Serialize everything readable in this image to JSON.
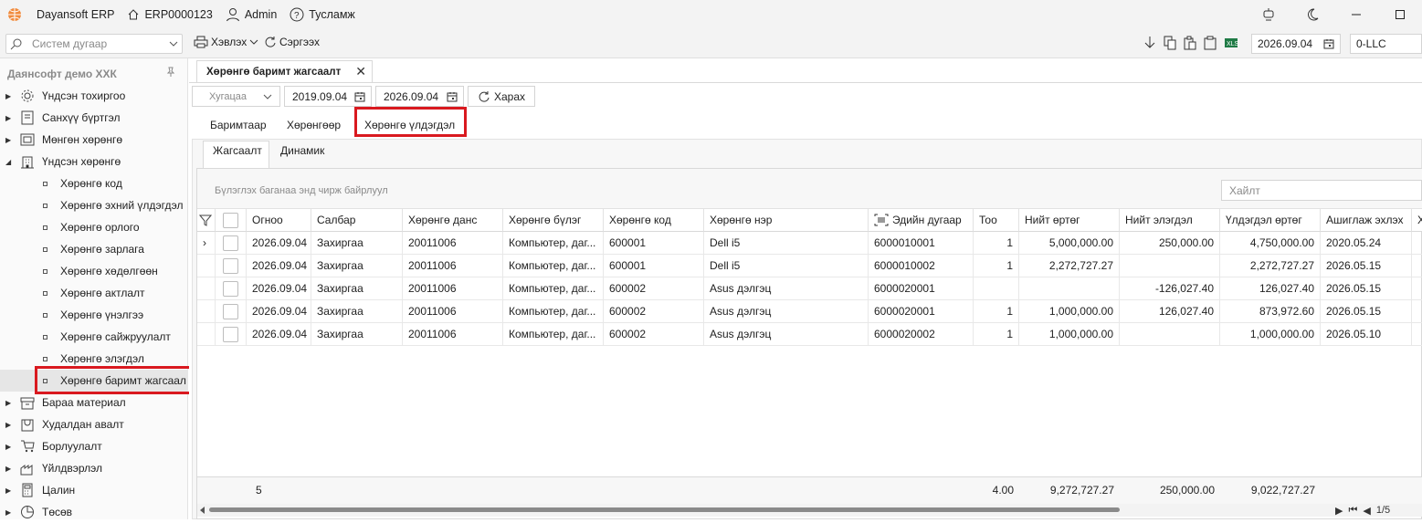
{
  "app": {
    "name": "Dayansoft ERP",
    "db": "ERP0000123",
    "user": "Admin",
    "help": "Тусламж"
  },
  "toolbar": {
    "search_placeholder": "Систем дугаар",
    "print_label": "Хэвлэх",
    "refresh_label": "Сэргээх",
    "date": "2026.09.04",
    "company_code": "0-LLC"
  },
  "sidebar": {
    "company": "Даянсофт демо ХХК",
    "items": [
      {
        "label": "Үндсэн тохиргоо",
        "icon": "gear-icon"
      },
      {
        "label": "Санхүү бүртгэл",
        "icon": "ledger-icon"
      },
      {
        "label": "Мөнгөн хөрөнгө",
        "icon": "cash-icon"
      },
      {
        "label": "Үндсэн хөрөнгө",
        "icon": "building-icon"
      }
    ],
    "subitems": [
      "Хөрөнгө код",
      "Хөрөнгө эхний үлдэгдэл",
      "Хөрөнгө орлого",
      "Хөрөнгө зарлага",
      "Хөрөнгө хөдөлгөөн",
      "Хөрөнгө актлалт",
      "Хөрөнгө үнэлгээ",
      "Хөрөнгө сайжруулалт",
      "Хөрөнгө элэгдэл",
      "Хөрөнгө баримт жагсаал"
    ],
    "items_after": [
      {
        "label": "Бараа материал",
        "icon": "box-icon"
      },
      {
        "label": "Худалдан авалт",
        "icon": "cart-icon"
      },
      {
        "label": "Борлуулалт",
        "icon": "sales-cart-icon"
      },
      {
        "label": "Үйлдвэрлэл",
        "icon": "factory-icon"
      },
      {
        "label": "Цалин",
        "icon": "calculator-icon"
      },
      {
        "label": "Төсөв",
        "icon": "pie-chart-icon"
      }
    ]
  },
  "document_tab": "Хөрөнгө баримт жагсаалт",
  "filter": {
    "period_placeholder": "Хугацаа",
    "date_from": "2019.09.04",
    "date_to": "2026.09.04",
    "view_label": "Харах"
  },
  "subtabs": [
    "Баримтаар",
    "Хөрөнгөөр",
    "Хөрөнгө үлдэгдэл"
  ],
  "view_tabs": [
    "Жагсаалт",
    "Динамик"
  ],
  "grid": {
    "group_hint": "Бүлэглэх баганаа энд чирж байрлуул",
    "find_placeholder": "Хайлт",
    "columns": [
      "Огноо",
      "Салбар",
      "Хөрөнгө данс",
      "Хөрөнгө бүлэг",
      "Хөрөнгө код",
      "Хөрөнгө нэр",
      "Эдийн дугаар",
      "Тоо",
      "Нийт өртөг",
      "Нийт элэгдэл",
      "Үлдэгдэл өртөг",
      "Ашиглаж эхлэх",
      "Х"
    ],
    "rows": [
      [
        "2026.09.04",
        "Захиргаа",
        "20011006",
        "Компьютер, даг...",
        "600001",
        "Dell i5",
        "6000010001",
        "1",
        "5,000,000.00",
        "250,000.00",
        "4,750,000.00",
        "2020.05.24"
      ],
      [
        "2026.09.04",
        "Захиргаа",
        "20011006",
        "Компьютер, даг...",
        "600001",
        "Dell i5",
        "6000010002",
        "1",
        "2,272,727.27",
        "",
        "2,272,727.27",
        "2026.05.15"
      ],
      [
        "2026.09.04",
        "Захиргаа",
        "20011006",
        "Компьютер, даг...",
        "600002",
        "Asus дэлгэц",
        "6000020001",
        "",
        "",
        "-126,027.40",
        "126,027.40",
        "2026.05.15"
      ],
      [
        "2026.09.04",
        "Захиргаа",
        "20011006",
        "Компьютер, даг...",
        "600002",
        "Asus дэлгэц",
        "6000020001",
        "1",
        "1,000,000.00",
        "126,027.40",
        "873,972.60",
        "2026.05.15"
      ],
      [
        "2026.09.04",
        "Захиргаа",
        "20011006",
        "Компьютер, даг...",
        "600002",
        "Asus дэлгэц",
        "6000020002",
        "1",
        "1,000,000.00",
        "",
        "1,000,000.00",
        "2026.05.10"
      ]
    ],
    "footer": {
      "count": "5",
      "qty": "4.00",
      "total_cost": "9,272,727.27",
      "total_depr": "250,000.00",
      "residual": "9,022,727.27"
    },
    "pager": "1/5"
  },
  "colors": {
    "highlight_box": "#d9191f",
    "chrome": "#f3f3f3"
  }
}
